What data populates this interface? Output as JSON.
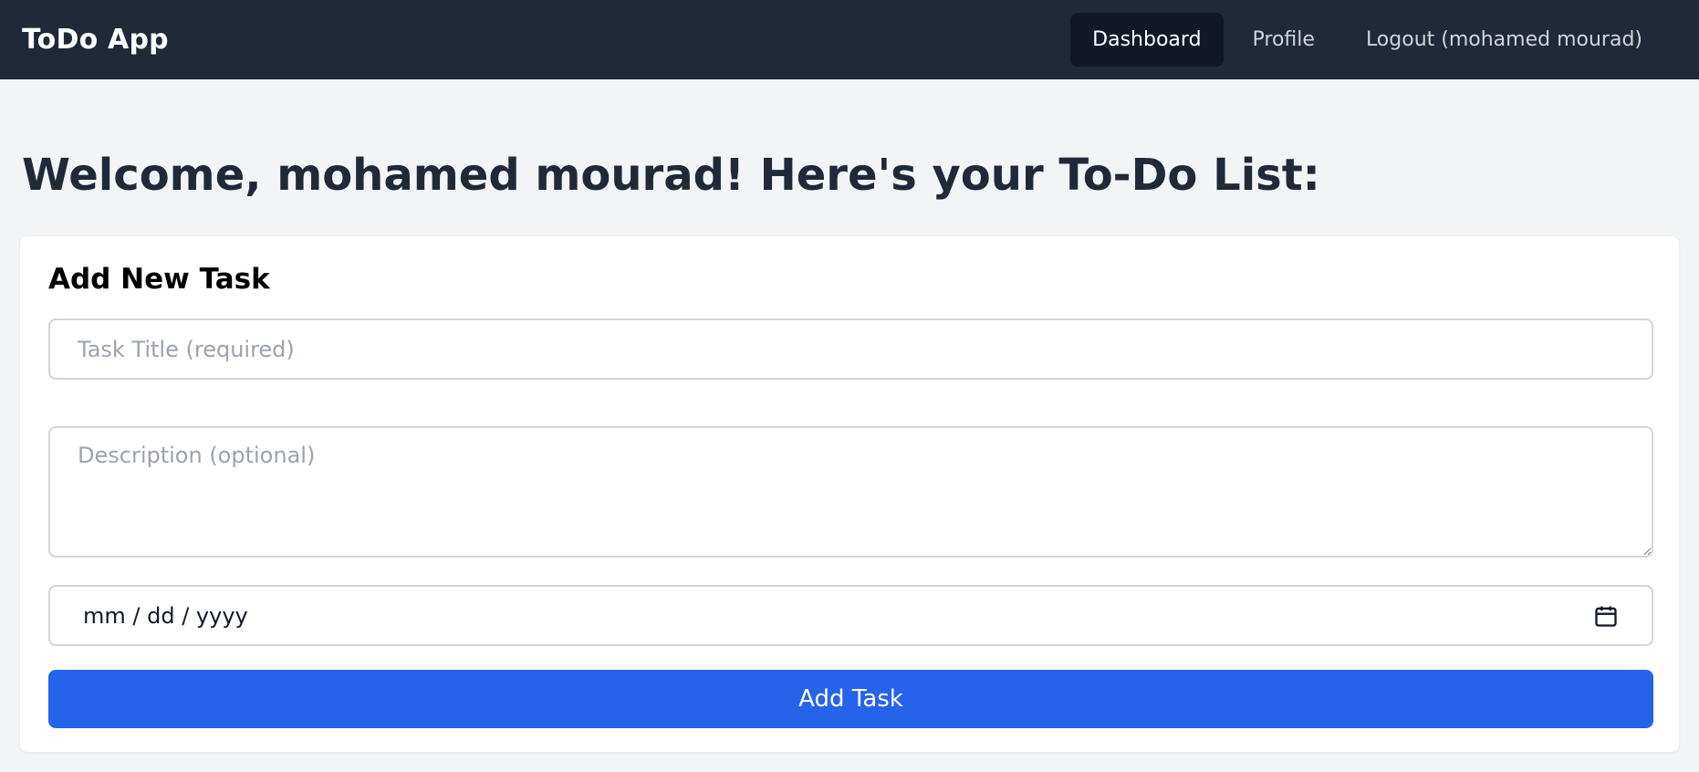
{
  "navbar": {
    "brand": "ToDo App",
    "links": [
      {
        "label": "Dashboard",
        "active": true
      },
      {
        "label": "Profile",
        "active": false
      },
      {
        "label": "Logout (mohamed mourad)",
        "active": false
      }
    ]
  },
  "main": {
    "title": "Welcome, mohamed mourad! Here's your To-Do List:"
  },
  "form": {
    "heading": "Add New Task",
    "title_field": {
      "value": "",
      "placeholder": "Task Title (required)"
    },
    "description_field": {
      "value": "",
      "placeholder": "Description (optional)"
    },
    "date_field": {
      "display": "mm / dd / yyyy",
      "icon": "calendar-icon"
    },
    "submit_label": "Add Task"
  },
  "colors": {
    "navbar_bg": "#1f2937",
    "active_link_bg": "#111827",
    "page_bg": "#f3f4f6",
    "primary_button": "#2563eb"
  }
}
